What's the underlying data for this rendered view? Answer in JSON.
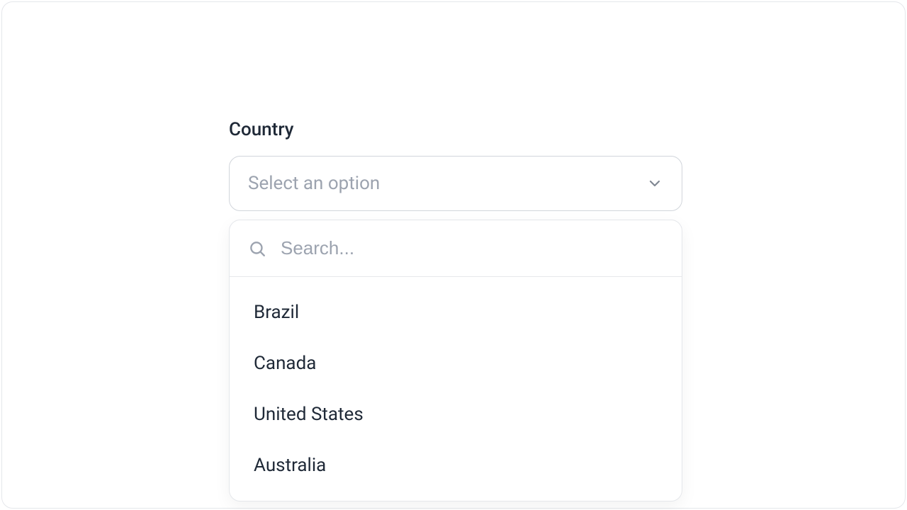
{
  "field": {
    "label": "Country",
    "placeholder": "Select an option"
  },
  "search": {
    "placeholder": "Search...",
    "value": ""
  },
  "options": [
    {
      "label": "Brazil"
    },
    {
      "label": "Canada"
    },
    {
      "label": "United States"
    },
    {
      "label": "Australia"
    }
  ]
}
